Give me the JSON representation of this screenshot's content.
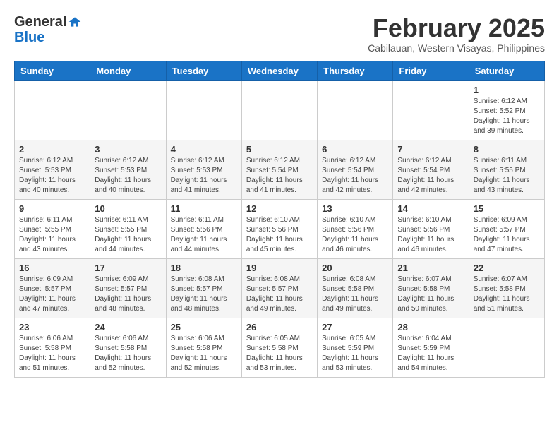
{
  "header": {
    "logo_line1": "General",
    "logo_line2": "Blue",
    "month_title": "February 2025",
    "location": "Cabilauan, Western Visayas, Philippines"
  },
  "weekdays": [
    "Sunday",
    "Monday",
    "Tuesday",
    "Wednesday",
    "Thursday",
    "Friday",
    "Saturday"
  ],
  "weeks": [
    [
      {
        "day": "",
        "sunrise": "",
        "sunset": "",
        "daylight": ""
      },
      {
        "day": "",
        "sunrise": "",
        "sunset": "",
        "daylight": ""
      },
      {
        "day": "",
        "sunrise": "",
        "sunset": "",
        "daylight": ""
      },
      {
        "day": "",
        "sunrise": "",
        "sunset": "",
        "daylight": ""
      },
      {
        "day": "",
        "sunrise": "",
        "sunset": "",
        "daylight": ""
      },
      {
        "day": "",
        "sunrise": "",
        "sunset": "",
        "daylight": ""
      },
      {
        "day": "1",
        "sunrise": "Sunrise: 6:12 AM",
        "sunset": "Sunset: 5:52 PM",
        "daylight": "Daylight: 11 hours and 39 minutes."
      }
    ],
    [
      {
        "day": "2",
        "sunrise": "Sunrise: 6:12 AM",
        "sunset": "Sunset: 5:53 PM",
        "daylight": "Daylight: 11 hours and 40 minutes."
      },
      {
        "day": "3",
        "sunrise": "Sunrise: 6:12 AM",
        "sunset": "Sunset: 5:53 PM",
        "daylight": "Daylight: 11 hours and 40 minutes."
      },
      {
        "day": "4",
        "sunrise": "Sunrise: 6:12 AM",
        "sunset": "Sunset: 5:53 PM",
        "daylight": "Daylight: 11 hours and 41 minutes."
      },
      {
        "day": "5",
        "sunrise": "Sunrise: 6:12 AM",
        "sunset": "Sunset: 5:54 PM",
        "daylight": "Daylight: 11 hours and 41 minutes."
      },
      {
        "day": "6",
        "sunrise": "Sunrise: 6:12 AM",
        "sunset": "Sunset: 5:54 PM",
        "daylight": "Daylight: 11 hours and 42 minutes."
      },
      {
        "day": "7",
        "sunrise": "Sunrise: 6:12 AM",
        "sunset": "Sunset: 5:54 PM",
        "daylight": "Daylight: 11 hours and 42 minutes."
      },
      {
        "day": "8",
        "sunrise": "Sunrise: 6:11 AM",
        "sunset": "Sunset: 5:55 PM",
        "daylight": "Daylight: 11 hours and 43 minutes."
      }
    ],
    [
      {
        "day": "9",
        "sunrise": "Sunrise: 6:11 AM",
        "sunset": "Sunset: 5:55 PM",
        "daylight": "Daylight: 11 hours and 43 minutes."
      },
      {
        "day": "10",
        "sunrise": "Sunrise: 6:11 AM",
        "sunset": "Sunset: 5:55 PM",
        "daylight": "Daylight: 11 hours and 44 minutes."
      },
      {
        "day": "11",
        "sunrise": "Sunrise: 6:11 AM",
        "sunset": "Sunset: 5:56 PM",
        "daylight": "Daylight: 11 hours and 44 minutes."
      },
      {
        "day": "12",
        "sunrise": "Sunrise: 6:10 AM",
        "sunset": "Sunset: 5:56 PM",
        "daylight": "Daylight: 11 hours and 45 minutes."
      },
      {
        "day": "13",
        "sunrise": "Sunrise: 6:10 AM",
        "sunset": "Sunset: 5:56 PM",
        "daylight": "Daylight: 11 hours and 46 minutes."
      },
      {
        "day": "14",
        "sunrise": "Sunrise: 6:10 AM",
        "sunset": "Sunset: 5:56 PM",
        "daylight": "Daylight: 11 hours and 46 minutes."
      },
      {
        "day": "15",
        "sunrise": "Sunrise: 6:09 AM",
        "sunset": "Sunset: 5:57 PM",
        "daylight": "Daylight: 11 hours and 47 minutes."
      }
    ],
    [
      {
        "day": "16",
        "sunrise": "Sunrise: 6:09 AM",
        "sunset": "Sunset: 5:57 PM",
        "daylight": "Daylight: 11 hours and 47 minutes."
      },
      {
        "day": "17",
        "sunrise": "Sunrise: 6:09 AM",
        "sunset": "Sunset: 5:57 PM",
        "daylight": "Daylight: 11 hours and 48 minutes."
      },
      {
        "day": "18",
        "sunrise": "Sunrise: 6:08 AM",
        "sunset": "Sunset: 5:57 PM",
        "daylight": "Daylight: 11 hours and 48 minutes."
      },
      {
        "day": "19",
        "sunrise": "Sunrise: 6:08 AM",
        "sunset": "Sunset: 5:57 PM",
        "daylight": "Daylight: 11 hours and 49 minutes."
      },
      {
        "day": "20",
        "sunrise": "Sunrise: 6:08 AM",
        "sunset": "Sunset: 5:58 PM",
        "daylight": "Daylight: 11 hours and 49 minutes."
      },
      {
        "day": "21",
        "sunrise": "Sunrise: 6:07 AM",
        "sunset": "Sunset: 5:58 PM",
        "daylight": "Daylight: 11 hours and 50 minutes."
      },
      {
        "day": "22",
        "sunrise": "Sunrise: 6:07 AM",
        "sunset": "Sunset: 5:58 PM",
        "daylight": "Daylight: 11 hours and 51 minutes."
      }
    ],
    [
      {
        "day": "23",
        "sunrise": "Sunrise: 6:06 AM",
        "sunset": "Sunset: 5:58 PM",
        "daylight": "Daylight: 11 hours and 51 minutes."
      },
      {
        "day": "24",
        "sunrise": "Sunrise: 6:06 AM",
        "sunset": "Sunset: 5:58 PM",
        "daylight": "Daylight: 11 hours and 52 minutes."
      },
      {
        "day": "25",
        "sunrise": "Sunrise: 6:06 AM",
        "sunset": "Sunset: 5:58 PM",
        "daylight": "Daylight: 11 hours and 52 minutes."
      },
      {
        "day": "26",
        "sunrise": "Sunrise: 6:05 AM",
        "sunset": "Sunset: 5:58 PM",
        "daylight": "Daylight: 11 hours and 53 minutes."
      },
      {
        "day": "27",
        "sunrise": "Sunrise: 6:05 AM",
        "sunset": "Sunset: 5:59 PM",
        "daylight": "Daylight: 11 hours and 53 minutes."
      },
      {
        "day": "28",
        "sunrise": "Sunrise: 6:04 AM",
        "sunset": "Sunset: 5:59 PM",
        "daylight": "Daylight: 11 hours and 54 minutes."
      },
      {
        "day": "",
        "sunrise": "",
        "sunset": "",
        "daylight": ""
      }
    ]
  ]
}
